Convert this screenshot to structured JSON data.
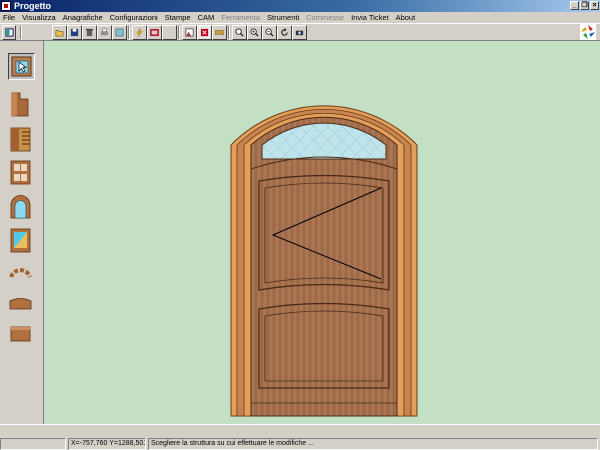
{
  "window": {
    "title": "Progetto",
    "minimize": "_",
    "restore": "❐",
    "close": "×"
  },
  "menu": [
    {
      "label": "File",
      "enabled": true
    },
    {
      "label": "Visualizza",
      "enabled": true
    },
    {
      "label": "Anagrafiche",
      "enabled": true
    },
    {
      "label": "Configurazioni",
      "enabled": true
    },
    {
      "label": "Stampe",
      "enabled": true
    },
    {
      "label": "CAM",
      "enabled": true
    },
    {
      "label": "Ferramenta",
      "enabled": false
    },
    {
      "label": "Strumenti",
      "enabled": true
    },
    {
      "label": "Commesse",
      "enabled": false
    },
    {
      "label": "Invia Ticket",
      "enabled": true
    },
    {
      "label": "About",
      "enabled": true
    }
  ],
  "toolbar": {
    "buttons": [
      "open-icon",
      "save-icon",
      "delete-icon",
      "print-icon",
      "copy-icon",
      "lightning-icon",
      "frame-red-icon",
      "blank-icon",
      "image-icon",
      "select-red-icon",
      "measure-icon",
      "zoom-fit-icon",
      "zoom-in-icon",
      "zoom-out-icon",
      "refresh-icon",
      "camera-icon"
    ]
  },
  "left_panel": {
    "tools": [
      "select-tool-icon",
      "frame-profile-icon",
      "joint-profile-icon",
      "window-grid-icon",
      "arch-window-icon",
      "glass-panel-icon",
      "arc-piece-icon",
      "curved-rail-icon",
      "straight-rail-icon"
    ],
    "active": "select-tool-icon"
  },
  "colors": {
    "canvas_bg": "#c4e0c4",
    "wood_dark": "#8b5a3c",
    "wood_light": "#a6714f",
    "frame_orange": "#e2a05c",
    "glass": "#bfe4ec"
  },
  "status": {
    "coords": "X=-757,760 Y=1288,501",
    "message": "Scegliere la struttura su cui effettuare le modifiche ..."
  }
}
